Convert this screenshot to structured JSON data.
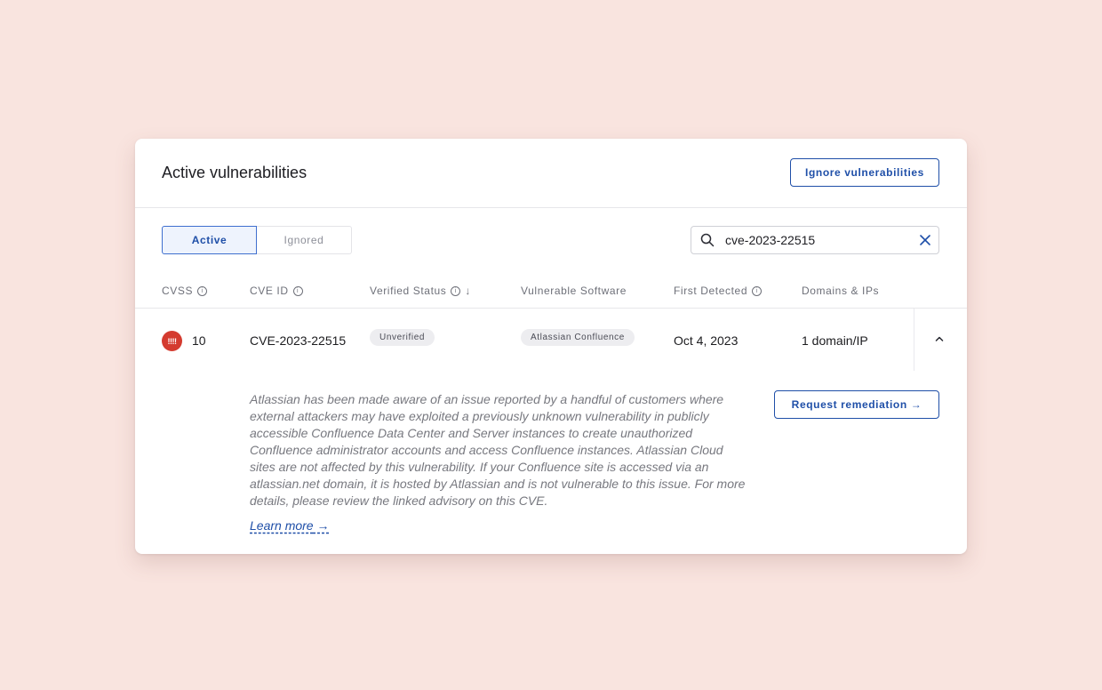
{
  "header": {
    "title": "Active vulnerabilities",
    "ignore_button": "Ignore vulnerabilities"
  },
  "tabs": [
    {
      "label": "Active",
      "selected": true
    },
    {
      "label": "Ignored",
      "selected": false
    }
  ],
  "search": {
    "value": "cve-2023-22515",
    "icon": "search-icon",
    "clear_icon": "close-icon"
  },
  "columns": {
    "cvss": "CVSS",
    "cve_id": "CVE ID",
    "verified_status": "Verified Status",
    "vulnerable_software": "Vulnerable Software",
    "first_detected": "First Detected",
    "domains_ips": "Domains & IPs"
  },
  "row": {
    "severity_badge": "!!!!",
    "cvss": "10",
    "cve_id": "CVE-2023-22515",
    "verified_status": "Unverified",
    "software": "Atlassian Confluence",
    "first_detected": "Oct 4, 2023",
    "domains": "1 domain/IP",
    "expanded": true
  },
  "details": {
    "description": "Atlassian has been made aware of an issue reported by a handful of customers where external attackers may have exploited a previously unknown vulnerability in publicly accessible Confluence Data Center and Server instances to create unauthorized Confluence administrator accounts and access Confluence instances. Atlassian Cloud sites are not affected by this vulnerability. If your Confluence site is accessed via an atlassian.net domain, it is hosted by Atlassian and is not vulnerable to this issue. For more details, please review the linked advisory on this CVE.",
    "learn_more": "Learn more",
    "request_button": "Request remediation"
  },
  "colors": {
    "accent": "#1f4fa8",
    "severity_critical": "#d43b2f",
    "background": "#f9e4df"
  }
}
